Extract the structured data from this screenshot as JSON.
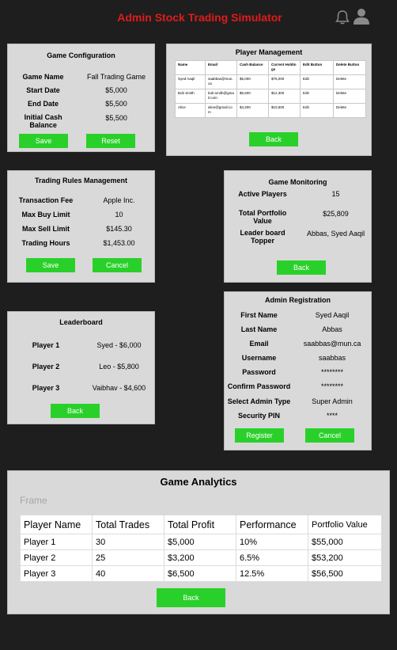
{
  "header": {
    "title": "Admin Stock Trading Simulator"
  },
  "game_config": {
    "title": "Game Configuration",
    "rows": [
      {
        "label": "Game Name",
        "value": "Fall Trading Game"
      },
      {
        "label": "Start Date",
        "value": "$5,000"
      },
      {
        "label": "End Date",
        "value": "$5,500"
      },
      {
        "label": "Initial Cash Balance",
        "value": "$5,500"
      }
    ],
    "save_label": "Save",
    "reset_label": "Reset"
  },
  "player_mgmt": {
    "title": "Player Management",
    "columns": [
      "Name",
      "Email",
      "Cash Balance",
      "Current Holdings",
      "Edit Button",
      "Delete Button"
    ],
    "rows": [
      [
        "Syed Aaqil",
        "saabbas@mun.ca",
        "$5,000",
        "$75,000",
        "Edit",
        "Delete"
      ],
      [
        "Bob Smith",
        "bob.smith@gmail.com",
        "$6,500",
        "$12,300",
        "Edit",
        "Delete"
      ],
      [
        "Alice",
        "alice@gmail.com",
        "$4,200",
        "$10,600",
        "Edit",
        "Delete"
      ]
    ],
    "back_label": "Back"
  },
  "trading_rules": {
    "title": "Trading Rules Management",
    "rows": [
      {
        "label": "Transaction Fee",
        "value": "Apple Inc."
      },
      {
        "label": "Max Buy Limit",
        "value": "10"
      },
      {
        "label": "Max Sell Limit",
        "value": "$145.30"
      },
      {
        "label": "Trading Hours",
        "value": "$1,453.00"
      }
    ],
    "save_label": "Save",
    "cancel_label": "Cancel"
  },
  "game_monitoring": {
    "title": "Game Monitoring",
    "rows": [
      {
        "label": "Active Players",
        "value": "15"
      },
      {
        "label": "Total Portfolio Value",
        "value": "$25,809"
      },
      {
        "label": "Leader board Topper",
        "value": "Abbas, Syed Aaqil"
      }
    ],
    "back_label": "Back"
  },
  "leaderboard": {
    "title": "Leaderboard",
    "rows": [
      {
        "label": "Player 1",
        "value": "Syed - $6,000"
      },
      {
        "label": "Player 2",
        "value": "Leo - $5,800"
      },
      {
        "label": "Player 3",
        "value": "Vaibhav - $4,600"
      }
    ],
    "back_label": "Back"
  },
  "admin_reg": {
    "title": "Admin Registration",
    "rows": [
      {
        "label": "First Name",
        "value": "Syed Aaqil"
      },
      {
        "label": "Last Name",
        "value": "Abbas"
      },
      {
        "label": "Email",
        "value": "saabbas@mun.ca"
      },
      {
        "label": "Username",
        "value": "saabbas"
      },
      {
        "label": "Password",
        "value": "********"
      },
      {
        "label": "Confirm Password",
        "value": "********"
      },
      {
        "label": "Select Admin Type",
        "value": "Super Admin"
      },
      {
        "label": "Security PIN",
        "value": "****"
      }
    ],
    "register_label": "Register",
    "cancel_label": "Cancel"
  },
  "analytics": {
    "title": "Game Analytics",
    "frame_label": "Frame",
    "columns": [
      "Player Name",
      "Total Trades",
      "Total Profit",
      "Performance",
      "Portfolio Value"
    ],
    "rows": [
      [
        "Player 1",
        "30",
        "$5,000",
        "10%",
        "$55,000"
      ],
      [
        "Player 2",
        "25",
        "$3,200",
        "6.5%",
        "$53,200"
      ],
      [
        "Player 3",
        "40",
        "$6,500",
        "12.5%",
        "$56,500"
      ]
    ],
    "back_label": "Back"
  },
  "colors": {
    "background": "#1e1e1e",
    "panel": "#d9d9d9",
    "accent_green": "#2ad02a",
    "title_red": "#e01b1b",
    "icon_gray": "#8a8a8a"
  },
  "icons": [
    "bell-icon",
    "user-avatar-icon"
  ]
}
